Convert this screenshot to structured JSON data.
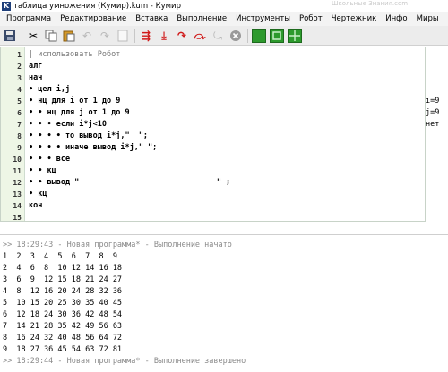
{
  "window": {
    "title": "таблица умножения (Кумир).kum - Кумир",
    "watermark": "Школьные Знания.com"
  },
  "menu": [
    "Программа",
    "Редактирование",
    "Вставка",
    "Выполнение",
    "Инструменты",
    "Робот",
    "Чертежник",
    "Инфо",
    "Миры"
  ],
  "toolbar_icons": [
    "save-icon",
    "cut-icon",
    "copy-icon",
    "paste-icon",
    "undo-icon",
    "redo-icon",
    "new-icon",
    "step-over-icon",
    "step-in-icon",
    "step-out-icon",
    "run-icon",
    "stop-icon",
    "robot-view-icon",
    "robot-panel-icon",
    "grid-icon"
  ],
  "editor": {
    "line_numbers": [
      "1",
      "2",
      "3",
      "4",
      "5",
      "6",
      "7",
      "8",
      "9",
      "10",
      "11",
      "12",
      "13",
      "14",
      "15"
    ],
    "lines": [
      "| использовать Робот",
      "алг",
      "нач",
      "• цел i,j",
      "• нц для i от 1 до 9",
      "• • нц для j от 1 до 9",
      "• • • если i*j<10",
      "• • • • то вывод i*j,\"  \";",
      "• • • • иначе вывод i*j,\" \";",
      "• • • все",
      "• • кц",
      "• • вывод \"                              \" ;",
      "• кц",
      "кон",
      ""
    ]
  },
  "margin": [
    "i=9",
    "j=9",
    "нет"
  ],
  "console": {
    "start": ">> 18:29:43 - Новая программа* - Выполнение начато",
    "rows": [
      "1  2  3  4  5  6  7  8  9",
      "2  4  6  8  10 12 14 16 18",
      "3  6  9  12 15 18 21 24 27",
      "4  8  12 16 20 24 28 32 36",
      "5  10 15 20 25 30 35 40 45",
      "6  12 18 24 30 36 42 48 54",
      "7  14 21 28 35 42 49 56 63",
      "8  16 24 32 40 48 56 64 72",
      "9  18 27 36 45 54 63 72 81"
    ],
    "end": ">> 18:29:44 - Новая программа* - Выполнение завершено"
  }
}
